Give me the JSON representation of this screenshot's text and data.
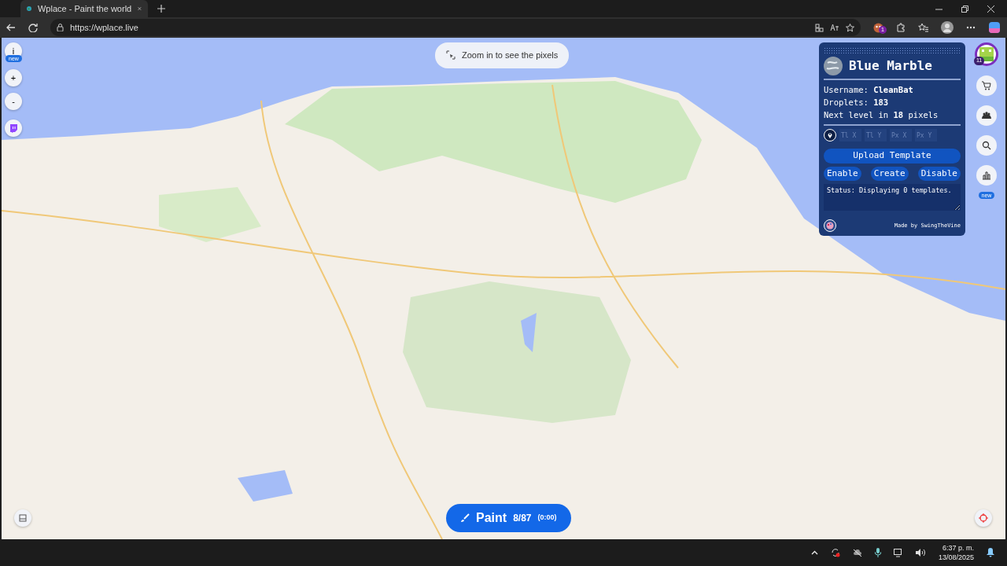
{
  "browser": {
    "tab_title": "Wplace - Paint the world",
    "url": "https://wplace.live",
    "extension_badge": "1"
  },
  "left_controls": {
    "info_label": "i",
    "info_badge": "new",
    "zoom_in": "+",
    "zoom_out": "-"
  },
  "zoom_hint": "Zoom in to see the pixels",
  "panel": {
    "title": "Blue Marble",
    "stats": [
      {
        "label": "Username:",
        "value": "CleanBat"
      },
      {
        "label": "Droplets:",
        "value": "183"
      }
    ],
    "next_level": "Next level in **18** pixels",
    "coordinates": [
      {
        "placeholder": "Tl X"
      },
      {
        "placeholder": "Tl Y"
      },
      {
        "placeholder": "Px X"
      },
      {
        "placeholder": "Px Y"
      }
    ],
    "upload_button": "Upload Template",
    "buttons": [
      "Enable",
      "Create",
      "Disable"
    ],
    "status": "Status: Displaying 0 templates.",
    "credit": "Made by SwingTheVine"
  },
  "right_rail": {
    "level_badge": "11",
    "stats_badge": "new"
  },
  "paint_button": {
    "label": "Paint",
    "charges": "8/87",
    "timer": "(0:00)"
  },
  "taskbar": {
    "time": "6:37 p. m.",
    "date": "13/08/2025"
  }
}
